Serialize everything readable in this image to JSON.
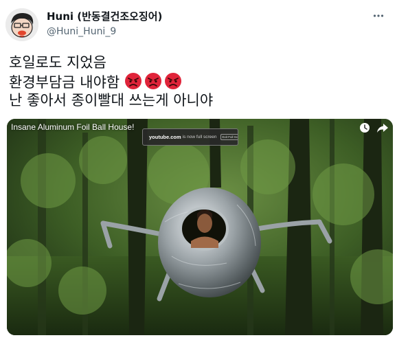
{
  "user": {
    "display_name": "Huni (반동결건조오징어)",
    "handle": "@Huni_Huni_9"
  },
  "tweet": {
    "line1": "호일로도 지었음",
    "line2": "환경부담금 내야함",
    "line3": "난 좋아서 종이빨대 쓰는게 아니야",
    "emoji_names": [
      "angry-face-icon",
      "angry-face-icon",
      "angry-face-icon"
    ]
  },
  "media": {
    "video_title": "Insane Aluminum Foil Ball House!",
    "fullscreen_domain": "youtube.com",
    "fullscreen_text": "is now full screen",
    "fullscreen_exit": "Exit Full Screen (Esc)",
    "icons": [
      "clock-icon",
      "share-icon"
    ]
  },
  "colors": {
    "text_primary": "#0f1419",
    "text_secondary": "#536471",
    "emoji_red": "#e0243a",
    "foliage": "#3f6b2a"
  }
}
